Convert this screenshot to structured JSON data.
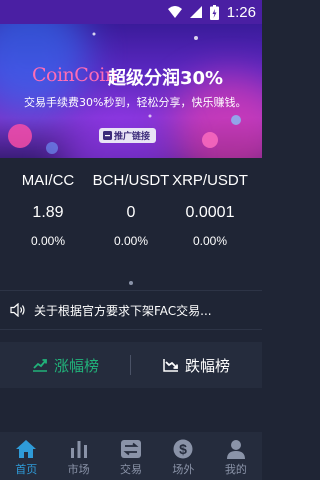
{
  "status": {
    "time": "1:26"
  },
  "banner": {
    "logo": "CoinCoin",
    "title": "超级分润30%",
    "subtitle": "交易手续费30%秒到，轻松分享，快乐赚钱。",
    "button": "推广链接"
  },
  "tickers": [
    {
      "pair": "MAI/CC",
      "price": "1.89",
      "change": "0.00%"
    },
    {
      "pair": "BCH/USDT",
      "price": "0",
      "change": "0.00%"
    },
    {
      "pair": "XRP/USDT",
      "price": "0.0001",
      "change": "0.00%"
    }
  ],
  "notice": {
    "text": "关于根据官方要求下架FAC交易..."
  },
  "ranking": {
    "gainers": "涨幅榜",
    "losers": "跌幅榜"
  },
  "tabs": [
    {
      "label": "首页",
      "icon": "home-icon"
    },
    {
      "label": "市场",
      "icon": "bar-chart-icon"
    },
    {
      "label": "交易",
      "icon": "exchange-icon"
    },
    {
      "label": "场外",
      "icon": "dollar-icon"
    },
    {
      "label": "我的",
      "icon": "user-icon"
    }
  ],
  "colors": {
    "active": "#2f9bd8",
    "up": "#21b27a",
    "background": "#1f2535"
  }
}
